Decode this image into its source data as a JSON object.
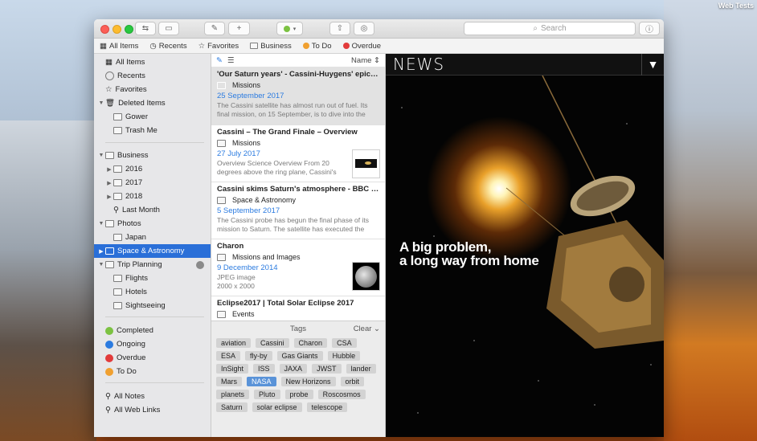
{
  "desktop": {
    "label": "Web Tests"
  },
  "search": {
    "placeholder": "Search"
  },
  "favorites_bar": [
    {
      "label": "All Items",
      "icon": "all-items-icon"
    },
    {
      "label": "Recents",
      "icon": "clock-icon"
    },
    {
      "label": "Favorites",
      "icon": "star-icon"
    },
    {
      "label": "Business",
      "icon": "folder-icon"
    },
    {
      "label": "To Do",
      "icon": "dot-icon",
      "color": "#f0a030"
    },
    {
      "label": "Overdue",
      "icon": "dot-icon",
      "color": "#e23b3b"
    }
  ],
  "sidebar": {
    "library": [
      "All Items",
      "Recents",
      "Favorites",
      "Deleted Items",
      "Gower",
      "Trash Me"
    ],
    "folders": [
      "Business",
      "2016",
      "2017",
      "2018",
      "Last Month",
      "Photos",
      "Japan",
      "Space & Astronomy",
      "Trip Planning",
      "Flights",
      "Hotels",
      "Sightseeing"
    ],
    "statuses": [
      {
        "label": "Completed",
        "color": "#7cc242"
      },
      {
        "label": "Ongoing",
        "color": "#2b7be0"
      },
      {
        "label": "Overdue",
        "color": "#e23b3b"
      },
      {
        "label": "To Do",
        "color": "#f0a030"
      }
    ],
    "smart": [
      "All Notes",
      "All Web Links"
    ]
  },
  "list": {
    "sort_label": "Name",
    "entries": [
      {
        "title": "'Our Saturn years' - Cassini-Huygens' epic jo...",
        "folder": "Missions",
        "date": "25 September 2017",
        "snippet": "The Cassini satellite has almost run out of fuel. Its final mission, on 15 September, is to dive into the planet's..."
      },
      {
        "title": "Cassini – The Grand Finale – Overview",
        "folder": "Missions",
        "date": "27 July 2017",
        "snippet": "Overview Science Overview From 20 degrees above the ring plane, Cassini's wi..."
      },
      {
        "title": "Cassini skims Saturn's atmosphere - BBC News",
        "folder": "Space & Astronomy",
        "date": "5 September 2017",
        "snippet": "The Cassini probe has begun the final phase of its mission to Saturn. The satellite has executed the first..."
      },
      {
        "title": "Charon",
        "folder": "Missions and Images",
        "date": "9 December 2014",
        "snippet": "JPEG image\n2000 x 2000"
      },
      {
        "title": "Eclipse2017 | Total Solar Eclipse 2017",
        "folder": "Events",
        "date": "",
        "snippet": ""
      }
    ]
  },
  "tags": {
    "title": "Tags",
    "clear_label": "Clear",
    "items": [
      "aviation",
      "Cassini",
      "Charon",
      "CSA",
      "ESA",
      "fly-by",
      "Gas Giants",
      "Hubble",
      "InSight",
      "ISS",
      "JAXA",
      "JWST",
      "lander",
      "Mars",
      "NASA",
      "New Horizons",
      "orbit",
      "planets",
      "Pluto",
      "probe",
      "Roscosmos",
      "Saturn",
      "solar eclipse",
      "telescope"
    ],
    "active": "NASA"
  },
  "preview": {
    "logo": "NEWS",
    "headline_line1": "A big problem,",
    "headline_line2": "a long way from home"
  }
}
